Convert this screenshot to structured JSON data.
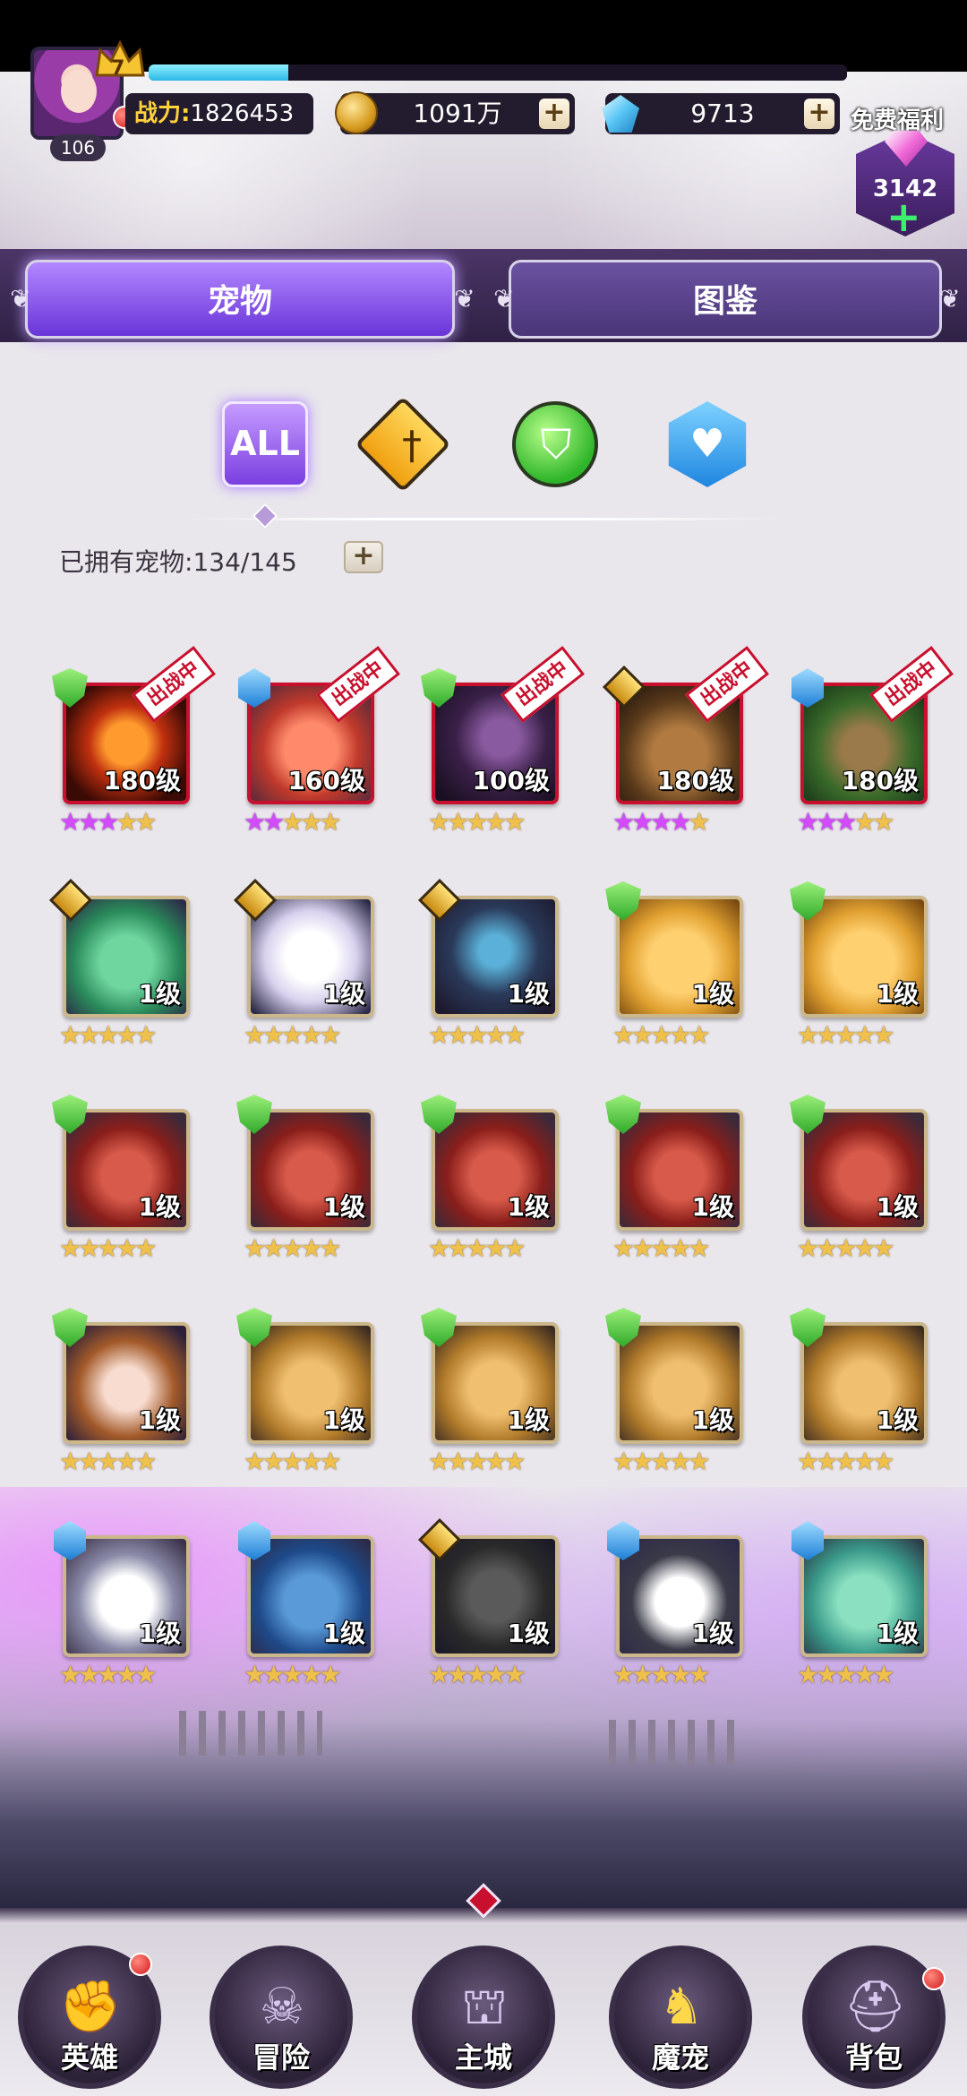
{
  "player": {
    "crown_level": "7",
    "level": "106",
    "xp_fraction": 0.2,
    "power_label": "战力:",
    "power_value": "1826453",
    "coins": "1091万",
    "gems": "9713",
    "free_benefit_label": "免费福利",
    "diamonds": "3142"
  },
  "tabs": [
    {
      "label": "宠物",
      "active": true
    },
    {
      "label": "图鉴",
      "active": false
    }
  ],
  "filters": [
    {
      "label": "ALL",
      "icon": "all-icon",
      "active": true
    },
    {
      "label": "",
      "icon": "attack-type-icon",
      "active": false
    },
    {
      "label": "",
      "icon": "defense-type-icon",
      "active": false
    },
    {
      "label": "",
      "icon": "support-type-icon",
      "active": false
    }
  ],
  "owned": {
    "label": "已拥有宠物:",
    "count": "134/145"
  },
  "deployed_label": "出战中",
  "pets": [
    {
      "level": "180级",
      "type": "green",
      "deployed": true,
      "purple_stars": 3,
      "stars": 5,
      "art": "lava-beast"
    },
    {
      "level": "160级",
      "type": "blue",
      "deployed": true,
      "purple_stars": 2,
      "stars": 5,
      "art": "fire-dragonling"
    },
    {
      "level": "100级",
      "type": "green",
      "deployed": true,
      "purple_stars": 0,
      "stars": 5,
      "art": "dark-dragon"
    },
    {
      "level": "180级",
      "type": "gold",
      "deployed": true,
      "purple_stars": 4,
      "stars": 5,
      "art": "horned-bear"
    },
    {
      "level": "180级",
      "type": "blue",
      "deployed": true,
      "purple_stars": 3,
      "stars": 5,
      "art": "treant"
    },
    {
      "level": "1级",
      "type": "gold",
      "deployed": false,
      "purple_stars": 0,
      "stars": 5,
      "art": "green-dragon"
    },
    {
      "level": "1级",
      "type": "gold",
      "deployed": false,
      "purple_stars": 0,
      "stars": 5,
      "art": "unicorn"
    },
    {
      "level": "1级",
      "type": "gold",
      "deployed": false,
      "purple_stars": 0,
      "stars": 5,
      "art": "penguin-knight"
    },
    {
      "level": "1级",
      "type": "green",
      "deployed": false,
      "purple_stars": 0,
      "stars": 5,
      "art": "lion-cub"
    },
    {
      "level": "1级",
      "type": "green",
      "deployed": false,
      "purple_stars": 0,
      "stars": 5,
      "art": "lion-cub"
    },
    {
      "level": "1级",
      "type": "green",
      "deployed": false,
      "purple_stars": 0,
      "stars": 5,
      "art": "minotaur"
    },
    {
      "level": "1级",
      "type": "green",
      "deployed": false,
      "purple_stars": 0,
      "stars": 5,
      "art": "minotaur"
    },
    {
      "level": "1级",
      "type": "green",
      "deployed": false,
      "purple_stars": 0,
      "stars": 5,
      "art": "minotaur"
    },
    {
      "level": "1级",
      "type": "green",
      "deployed": false,
      "purple_stars": 0,
      "stars": 5,
      "art": "minotaur"
    },
    {
      "level": "1级",
      "type": "green",
      "deployed": false,
      "purple_stars": 0,
      "stars": 5,
      "art": "minotaur"
    },
    {
      "level": "1级",
      "type": "green",
      "deployed": false,
      "purple_stars": 0,
      "stars": 5,
      "art": "elf-girl"
    },
    {
      "level": "1级",
      "type": "green",
      "deployed": false,
      "purple_stars": 0,
      "stars": 5,
      "art": "sabertooth"
    },
    {
      "level": "1级",
      "type": "green",
      "deployed": false,
      "purple_stars": 0,
      "stars": 5,
      "art": "sabertooth"
    },
    {
      "level": "1级",
      "type": "green",
      "deployed": false,
      "purple_stars": 0,
      "stars": 5,
      "art": "sabertooth"
    },
    {
      "level": "1级",
      "type": "green",
      "deployed": false,
      "purple_stars": 0,
      "stars": 5,
      "art": "sabertooth"
    },
    {
      "level": "1级",
      "type": "blue",
      "deployed": false,
      "purple_stars": 0,
      "stars": 5,
      "art": "ninja-cat"
    },
    {
      "level": "1级",
      "type": "blue",
      "deployed": false,
      "purple_stars": 0,
      "stars": 5,
      "art": "shark"
    },
    {
      "level": "1级",
      "type": "gold",
      "deployed": false,
      "purple_stars": 0,
      "stars": 5,
      "art": "black-wolf"
    },
    {
      "level": "1级",
      "type": "blue",
      "deployed": false,
      "purple_stars": 0,
      "stars": 5,
      "art": "husky"
    },
    {
      "level": "1级",
      "type": "blue",
      "deployed": false,
      "purple_stars": 0,
      "stars": 5,
      "art": "green-lizard"
    }
  ],
  "nav": [
    {
      "label": "英雄",
      "icon": "fist-icon",
      "badge": true,
      "active": false
    },
    {
      "label": "冒险",
      "icon": "demon-mask-icon",
      "badge": false,
      "active": false
    },
    {
      "label": "主城",
      "icon": "castle-gate-icon",
      "badge": false,
      "active": false
    },
    {
      "label": "魔宠",
      "icon": "dragon-icon",
      "badge": false,
      "active": true
    },
    {
      "label": "背包",
      "icon": "helmet-icon",
      "badge": true,
      "active": false
    }
  ]
}
